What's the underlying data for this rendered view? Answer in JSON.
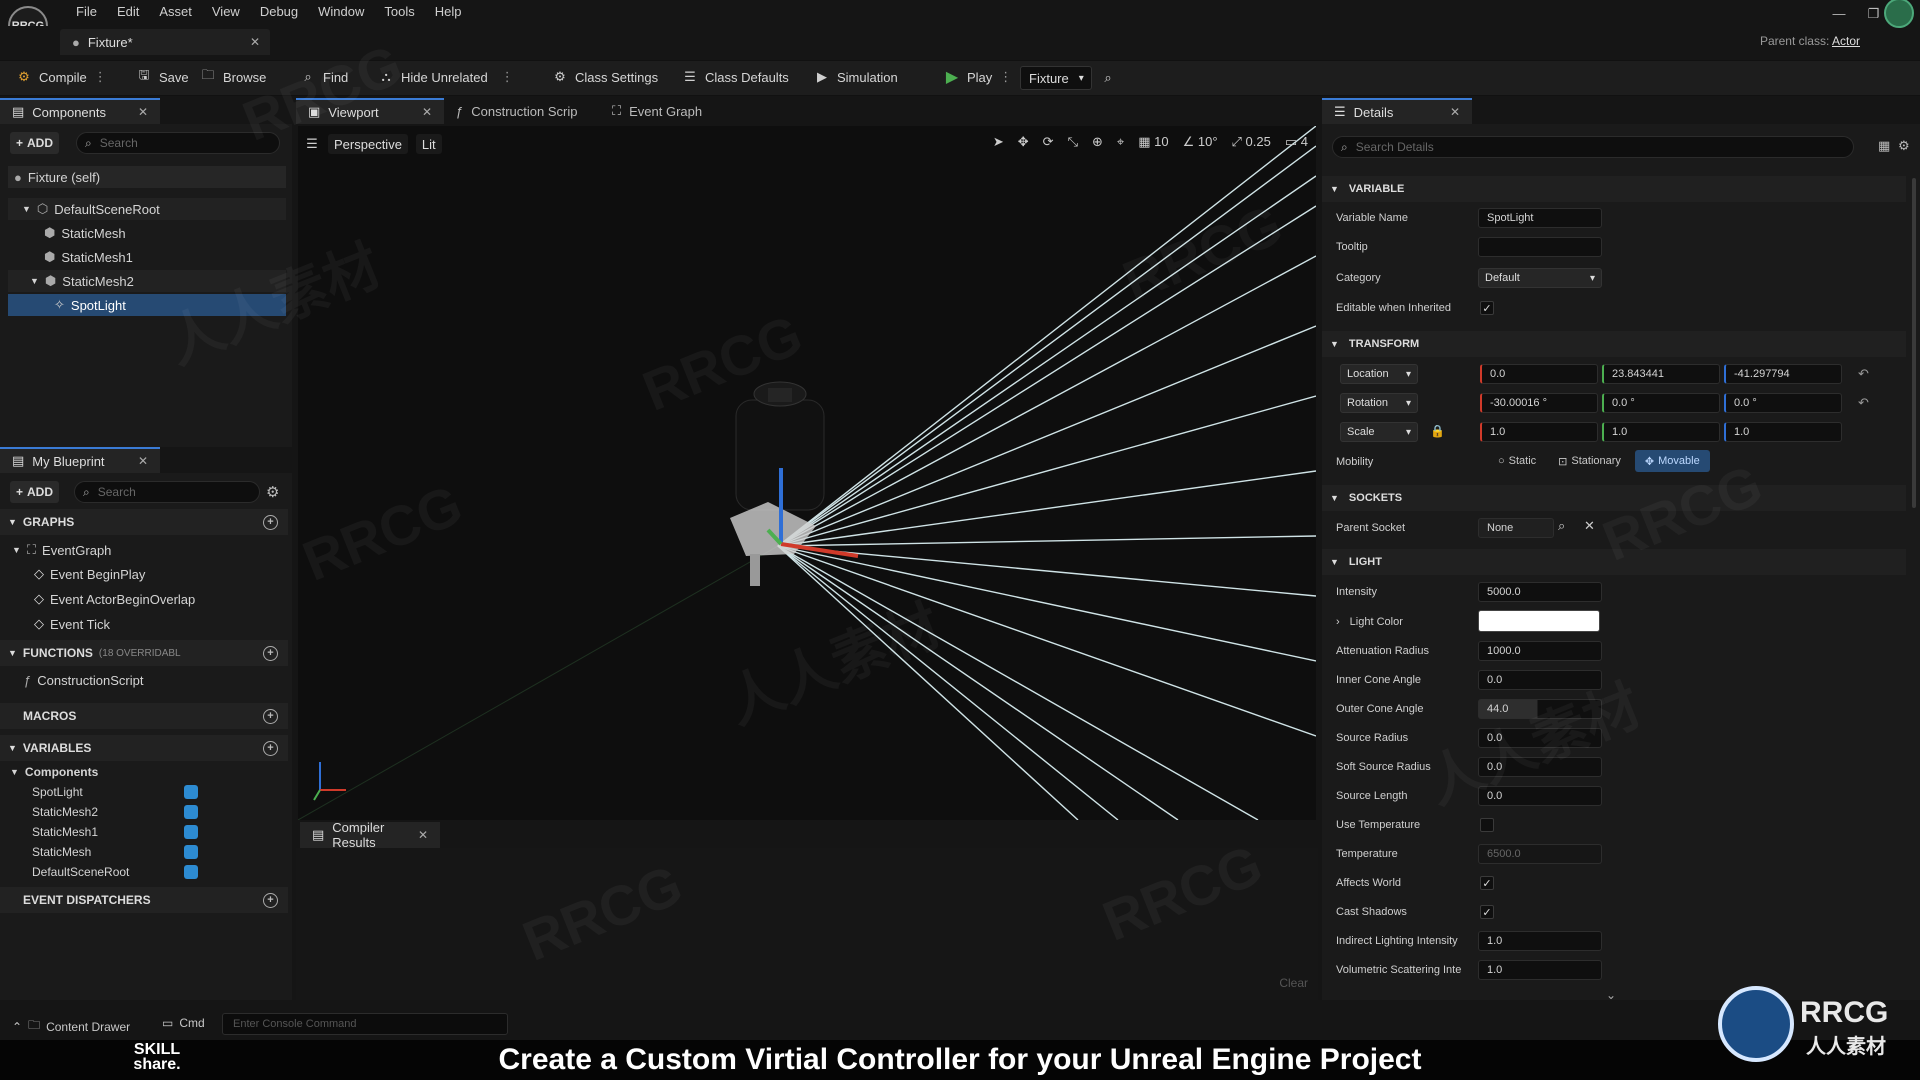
{
  "menubar": {
    "items": [
      "File",
      "Edit",
      "Asset",
      "View",
      "Debug",
      "Window",
      "Tools",
      "Help"
    ],
    "logo_text": "RRCG"
  },
  "document": {
    "tab_title": "Fixture*",
    "parent_class_label": "Parent class:",
    "parent_class_value": "Actor"
  },
  "toolbar": {
    "compile": "Compile",
    "save": "Save",
    "browse": "Browse",
    "find": "Find",
    "hide_unrelated": "Hide Unrelated",
    "class_settings": "Class Settings",
    "class_defaults": "Class Defaults",
    "simulation": "Simulation",
    "play": "Play",
    "debug_object": "Fixture"
  },
  "components_panel": {
    "title": "Components",
    "add": "ADD",
    "search_placeholder": "Search",
    "self_label": "Fixture (self)",
    "tree": [
      "DefaultSceneRoot",
      "StaticMesh",
      "StaticMesh1",
      "StaticMesh2",
      "SpotLight"
    ]
  },
  "blueprint_panel": {
    "title": "My Blueprint",
    "add": "ADD",
    "search_placeholder": "Search",
    "graphs_header": "GRAPHS",
    "event_graph": "EventGraph",
    "events": [
      "Event BeginPlay",
      "Event ActorBeginOverlap",
      "Event Tick"
    ],
    "functions_header": "FUNCTIONS",
    "functions_count": "(18 OVERRIDABL",
    "construction_script": "ConstructionScript",
    "macros_header": "MACROS",
    "variables_header": "VARIABLES",
    "components_group": "Components",
    "variables": [
      "SpotLight",
      "StaticMesh2",
      "StaticMesh1",
      "StaticMesh",
      "DefaultSceneRoot"
    ],
    "dispatchers_header": "EVENT DISPATCHERS"
  },
  "editor_tabs": {
    "viewport": "Viewport",
    "construction": "Construction Scrip",
    "event_graph": "Event Graph"
  },
  "viewport": {
    "perspective": "Perspective",
    "lit": "Lit",
    "grid_snap": "10",
    "rotation_snap": "10°",
    "scale_snap": "0.25",
    "camera_speed": "4"
  },
  "compiler": {
    "title": "Compiler Results",
    "clear": "Clear"
  },
  "details": {
    "title": "Details",
    "search_placeholder": "Search Details",
    "variable_section": "VARIABLE",
    "variable_name_label": "Variable Name",
    "variable_name": "SpotLight",
    "tooltip_label": "Tooltip",
    "tooltip_value": "",
    "category_label": "Category",
    "category_value": "Default",
    "editable_label": "Editable when Inherited",
    "transform_section": "TRANSFORM",
    "location_label": "Location",
    "location": [
      "0.0",
      "23.843441",
      "-41.297794"
    ],
    "rotation_label": "Rotation",
    "rotation": [
      "-30.00016 °",
      "0.0 °",
      "0.0 °"
    ],
    "scale_label": "Scale",
    "scale": [
      "1.0",
      "1.0",
      "1.0"
    ],
    "mobility_label": "Mobility",
    "mobility_options": [
      "Static",
      "Stationary",
      "Movable"
    ],
    "mobility_selected": "Movable",
    "sockets_section": "SOCKETS",
    "parent_socket_label": "Parent Socket",
    "parent_socket_value": "None",
    "light_section": "LIGHT",
    "intensity_label": "Intensity",
    "intensity": "5000.0",
    "light_color_label": "Light Color",
    "light_color": "#ffffff",
    "attenuation_label": "Attenuation Radius",
    "attenuation": "1000.0",
    "inner_cone_label": "Inner Cone Angle",
    "inner_cone": "0.0",
    "outer_cone_label": "Outer Cone Angle",
    "outer_cone": "44.0",
    "source_radius_label": "Source Radius",
    "source_radius": "0.0",
    "soft_source_label": "Soft Source Radius",
    "soft_source": "0.0",
    "source_length_label": "Source Length",
    "source_length": "0.0",
    "use_temp_label": "Use Temperature",
    "temperature_label": "Temperature",
    "temperature": "6500.0",
    "affects_world_label": "Affects World",
    "cast_shadows_label": "Cast Shadows",
    "indirect_label": "Indirect Lighting Intensity",
    "indirect": "1.0",
    "volumetric_label": "Volumetric Scattering Inte",
    "volumetric": "1.0"
  },
  "bottom": {
    "content_drawer": "Content Drawer",
    "cmd": "Cmd",
    "console_placeholder": "Enter Console Command"
  },
  "banner": {
    "text": "Create a Custom Virtial Controller for your Unreal Engine Project",
    "left_logo": "SKILL share.",
    "right_logo": "RRCG",
    "right_logo_sub": "人人素材"
  },
  "watermarks": [
    "RRCG",
    "人人素材"
  ],
  "colors": {
    "accent": "#3a7bd5",
    "selected_row": "#264a73",
    "x_axis": "#d03a2a",
    "y_axis": "#4caf50",
    "z_axis": "#2f6fd6",
    "play_green": "#4caf50"
  }
}
